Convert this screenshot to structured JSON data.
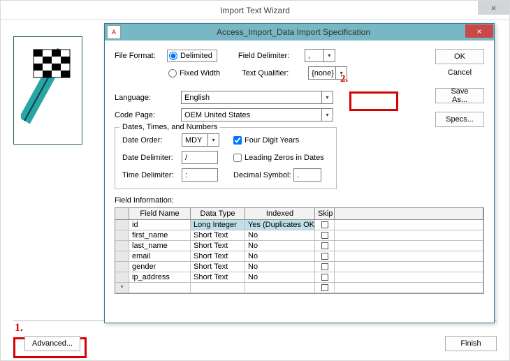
{
  "outer": {
    "title": "Import Text Wizard",
    "close_glyph": "×",
    "advanced_label": "Advanced...",
    "finish_label": "Finish"
  },
  "annotations": {
    "one": "1.",
    "two": "2."
  },
  "inner": {
    "title": "Access_Import_Data Import Specification",
    "close_glyph": "×",
    "labels": {
      "file_format": "File Format:",
      "delimited": "Delimited",
      "fixed_width": "Fixed Width",
      "field_delimiter": "Field Delimiter:",
      "text_qualifier": "Text Qualifier:",
      "language": "Language:",
      "code_page": "Code Page:",
      "dates_group": "Dates, Times, and Numbers",
      "date_order": "Date Order:",
      "date_delim": "Date Delimiter:",
      "time_delim": "Time Delimiter:",
      "four_digit": "Four Digit Years",
      "leading_zeros": "Leading Zeros in Dates",
      "decimal_symbol": "Decimal Symbol:",
      "field_info": "Field Information:"
    },
    "values": {
      "field_delimiter": ",",
      "text_qualifier": "{none}",
      "language": "English",
      "code_page": "OEM United States",
      "date_order": "MDY",
      "date_delim": "/",
      "time_delim": ":",
      "decimal_symbol": "."
    },
    "buttons": {
      "ok": "OK",
      "cancel": "Cancel",
      "save_as": "Save As...",
      "specs": "Specs..."
    },
    "grid": {
      "headers": {
        "name": "Field Name",
        "type": "Data Type",
        "indexed": "Indexed",
        "skip": "Skip"
      },
      "rows": [
        {
          "name": "id",
          "type": "Long Integer",
          "indexed": "Yes (Duplicates OK)",
          "highlight": true
        },
        {
          "name": "first_name",
          "type": "Short Text",
          "indexed": "No"
        },
        {
          "name": "last_name",
          "type": "Short Text",
          "indexed": "No"
        },
        {
          "name": "email",
          "type": "Short Text",
          "indexed": "No"
        },
        {
          "name": "gender",
          "type": "Short Text",
          "indexed": "No"
        },
        {
          "name": "ip_address",
          "type": "Short Text",
          "indexed": "No"
        }
      ],
      "new_row_marker": "*"
    }
  }
}
